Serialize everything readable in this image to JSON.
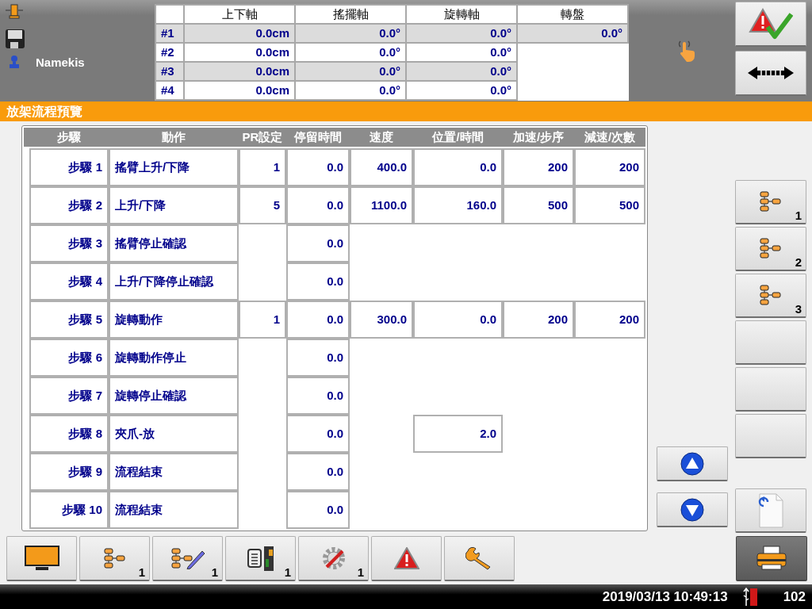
{
  "header": {
    "user": "Namekis"
  },
  "axis_table": {
    "columns": [
      "上下軸",
      "搖擺軸",
      "旋轉軸",
      "轉盤"
    ],
    "rows": [
      {
        "label": "#1",
        "values": [
          "0.0cm",
          "0.0°",
          "0.0°",
          "0.0°"
        ]
      },
      {
        "label": "#2",
        "values": [
          "0.0cm",
          "0.0°",
          "0.0°"
        ]
      },
      {
        "label": "#3",
        "values": [
          "0.0cm",
          "0.0°",
          "0.0°"
        ]
      },
      {
        "label": "#4",
        "values": [
          "0.0cm",
          "0.0°",
          "0.0°"
        ]
      }
    ]
  },
  "top_buttons": [
    {
      "kind": "alarm-check"
    },
    {
      "kind": "arrows"
    }
  ],
  "title": "放架流程預覽",
  "steps_table": {
    "columns": [
      "步驟",
      "動作",
      "PR設定",
      "停留時間",
      "速度",
      "位置/時間",
      "加速/步序",
      "減速/次數"
    ],
    "rows": [
      {
        "cells": [
          "步驟 1",
          "搖臂上升/下降",
          "1",
          "0.0",
          "400.0",
          "0.0",
          "200",
          "200"
        ]
      },
      {
        "cells": [
          "步驟 2",
          "上升/下降",
          "5",
          "0.0",
          "1100.0",
          "160.0",
          "500",
          "500"
        ]
      },
      {
        "cells": [
          "步驟 3",
          "搖臂停止確認",
          "",
          "0.0"
        ]
      },
      {
        "cells": [
          "步驟 4",
          "上升/下降停止確認",
          "",
          "0.0"
        ]
      },
      {
        "cells": [
          "步驟 5",
          "旋轉動作",
          "1",
          "0.0",
          "300.0",
          "0.0",
          "200",
          "200"
        ]
      },
      {
        "cells": [
          "步驟 6",
          "旋轉動作停止",
          "",
          "0.0"
        ]
      },
      {
        "cells": [
          "步驟 7",
          "旋轉停止確認",
          "",
          "0.0"
        ]
      },
      {
        "cells": [
          "步驟 8",
          "夾爪-放",
          "",
          "0.0",
          "",
          "2.0"
        ]
      },
      {
        "cells": [
          "步驟 9",
          "流程結束",
          "",
          "0.0"
        ]
      },
      {
        "cells": [
          "步驟 10",
          "流程結束",
          "",
          "0.0"
        ]
      }
    ]
  },
  "scroll_buttons": [
    {
      "kind": "up"
    },
    {
      "kind": "down"
    }
  ],
  "side_buttons": [
    {
      "kind": "flow",
      "badge": "1"
    },
    {
      "kind": "flow",
      "badge": "2"
    },
    {
      "kind": "flow",
      "badge": "3"
    },
    {
      "kind": "blank"
    },
    {
      "kind": "blank"
    },
    {
      "kind": "blank"
    }
  ],
  "undo_button": {
    "kind": "undo-doc"
  },
  "toolbar": [
    {
      "kind": "monitor",
      "selected": false
    },
    {
      "kind": "flow",
      "badge": "1",
      "selected": false
    },
    {
      "kind": "flow-edit",
      "badge": "1",
      "selected": false
    },
    {
      "kind": "io",
      "badge": "1",
      "selected": false
    },
    {
      "kind": "gear",
      "badge": "1",
      "selected": false
    },
    {
      "kind": "alarm",
      "selected": false
    },
    {
      "kind": "wrench",
      "selected": false
    },
    {
      "kind": "printer",
      "selected": true
    }
  ],
  "status_bar": {
    "datetime": "2019/03/13 10:49:13",
    "counter": "102"
  }
}
